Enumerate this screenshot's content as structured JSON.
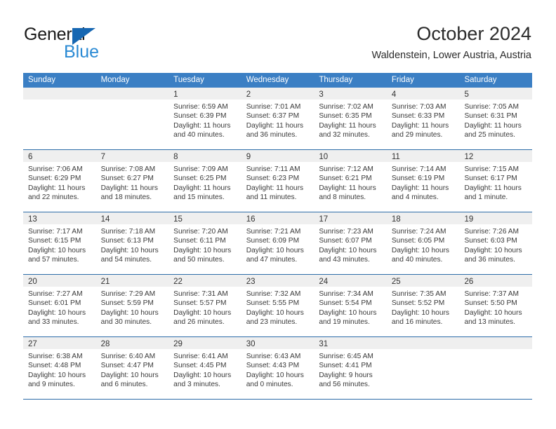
{
  "brand": {
    "name_part1": "General",
    "name_part2": "Blue"
  },
  "header": {
    "title": "October 2024",
    "subtitle": "Waldenstein, Lower Austria, Austria"
  },
  "colors": {
    "header_blue": "#3b7fc4",
    "row_divider": "#2c6ca8",
    "day_strip": "#efefef",
    "brand_blue": "#2a8ad4",
    "brand_triangle": "#1667b2"
  },
  "weekdays": [
    "Sunday",
    "Monday",
    "Tuesday",
    "Wednesday",
    "Thursday",
    "Friday",
    "Saturday"
  ],
  "weeks": [
    [
      {
        "day": "",
        "lines": []
      },
      {
        "day": "",
        "lines": []
      },
      {
        "day": "1",
        "lines": [
          "Sunrise: 6:59 AM",
          "Sunset: 6:39 PM",
          "Daylight: 11 hours",
          "and 40 minutes."
        ]
      },
      {
        "day": "2",
        "lines": [
          "Sunrise: 7:01 AM",
          "Sunset: 6:37 PM",
          "Daylight: 11 hours",
          "and 36 minutes."
        ]
      },
      {
        "day": "3",
        "lines": [
          "Sunrise: 7:02 AM",
          "Sunset: 6:35 PM",
          "Daylight: 11 hours",
          "and 32 minutes."
        ]
      },
      {
        "day": "4",
        "lines": [
          "Sunrise: 7:03 AM",
          "Sunset: 6:33 PM",
          "Daylight: 11 hours",
          "and 29 minutes."
        ]
      },
      {
        "day": "5",
        "lines": [
          "Sunrise: 7:05 AM",
          "Sunset: 6:31 PM",
          "Daylight: 11 hours",
          "and 25 minutes."
        ]
      }
    ],
    [
      {
        "day": "6",
        "lines": [
          "Sunrise: 7:06 AM",
          "Sunset: 6:29 PM",
          "Daylight: 11 hours",
          "and 22 minutes."
        ]
      },
      {
        "day": "7",
        "lines": [
          "Sunrise: 7:08 AM",
          "Sunset: 6:27 PM",
          "Daylight: 11 hours",
          "and 18 minutes."
        ]
      },
      {
        "day": "8",
        "lines": [
          "Sunrise: 7:09 AM",
          "Sunset: 6:25 PM",
          "Daylight: 11 hours",
          "and 15 minutes."
        ]
      },
      {
        "day": "9",
        "lines": [
          "Sunrise: 7:11 AM",
          "Sunset: 6:23 PM",
          "Daylight: 11 hours",
          "and 11 minutes."
        ]
      },
      {
        "day": "10",
        "lines": [
          "Sunrise: 7:12 AM",
          "Sunset: 6:21 PM",
          "Daylight: 11 hours",
          "and 8 minutes."
        ]
      },
      {
        "day": "11",
        "lines": [
          "Sunrise: 7:14 AM",
          "Sunset: 6:19 PM",
          "Daylight: 11 hours",
          "and 4 minutes."
        ]
      },
      {
        "day": "12",
        "lines": [
          "Sunrise: 7:15 AM",
          "Sunset: 6:17 PM",
          "Daylight: 11 hours",
          "and 1 minute."
        ]
      }
    ],
    [
      {
        "day": "13",
        "lines": [
          "Sunrise: 7:17 AM",
          "Sunset: 6:15 PM",
          "Daylight: 10 hours",
          "and 57 minutes."
        ]
      },
      {
        "day": "14",
        "lines": [
          "Sunrise: 7:18 AM",
          "Sunset: 6:13 PM",
          "Daylight: 10 hours",
          "and 54 minutes."
        ]
      },
      {
        "day": "15",
        "lines": [
          "Sunrise: 7:20 AM",
          "Sunset: 6:11 PM",
          "Daylight: 10 hours",
          "and 50 minutes."
        ]
      },
      {
        "day": "16",
        "lines": [
          "Sunrise: 7:21 AM",
          "Sunset: 6:09 PM",
          "Daylight: 10 hours",
          "and 47 minutes."
        ]
      },
      {
        "day": "17",
        "lines": [
          "Sunrise: 7:23 AM",
          "Sunset: 6:07 PM",
          "Daylight: 10 hours",
          "and 43 minutes."
        ]
      },
      {
        "day": "18",
        "lines": [
          "Sunrise: 7:24 AM",
          "Sunset: 6:05 PM",
          "Daylight: 10 hours",
          "and 40 minutes."
        ]
      },
      {
        "day": "19",
        "lines": [
          "Sunrise: 7:26 AM",
          "Sunset: 6:03 PM",
          "Daylight: 10 hours",
          "and 36 minutes."
        ]
      }
    ],
    [
      {
        "day": "20",
        "lines": [
          "Sunrise: 7:27 AM",
          "Sunset: 6:01 PM",
          "Daylight: 10 hours",
          "and 33 minutes."
        ]
      },
      {
        "day": "21",
        "lines": [
          "Sunrise: 7:29 AM",
          "Sunset: 5:59 PM",
          "Daylight: 10 hours",
          "and 30 minutes."
        ]
      },
      {
        "day": "22",
        "lines": [
          "Sunrise: 7:31 AM",
          "Sunset: 5:57 PM",
          "Daylight: 10 hours",
          "and 26 minutes."
        ]
      },
      {
        "day": "23",
        "lines": [
          "Sunrise: 7:32 AM",
          "Sunset: 5:55 PM",
          "Daylight: 10 hours",
          "and 23 minutes."
        ]
      },
      {
        "day": "24",
        "lines": [
          "Sunrise: 7:34 AM",
          "Sunset: 5:54 PM",
          "Daylight: 10 hours",
          "and 19 minutes."
        ]
      },
      {
        "day": "25",
        "lines": [
          "Sunrise: 7:35 AM",
          "Sunset: 5:52 PM",
          "Daylight: 10 hours",
          "and 16 minutes."
        ]
      },
      {
        "day": "26",
        "lines": [
          "Sunrise: 7:37 AM",
          "Sunset: 5:50 PM",
          "Daylight: 10 hours",
          "and 13 minutes."
        ]
      }
    ],
    [
      {
        "day": "27",
        "lines": [
          "Sunrise: 6:38 AM",
          "Sunset: 4:48 PM",
          "Daylight: 10 hours",
          "and 9 minutes."
        ]
      },
      {
        "day": "28",
        "lines": [
          "Sunrise: 6:40 AM",
          "Sunset: 4:47 PM",
          "Daylight: 10 hours",
          "and 6 minutes."
        ]
      },
      {
        "day": "29",
        "lines": [
          "Sunrise: 6:41 AM",
          "Sunset: 4:45 PM",
          "Daylight: 10 hours",
          "and 3 minutes."
        ]
      },
      {
        "day": "30",
        "lines": [
          "Sunrise: 6:43 AM",
          "Sunset: 4:43 PM",
          "Daylight: 10 hours",
          "and 0 minutes."
        ]
      },
      {
        "day": "31",
        "lines": [
          "Sunrise: 6:45 AM",
          "Sunset: 4:41 PM",
          "Daylight: 9 hours",
          "and 56 minutes."
        ]
      },
      {
        "day": "",
        "lines": []
      },
      {
        "day": "",
        "lines": []
      }
    ]
  ]
}
